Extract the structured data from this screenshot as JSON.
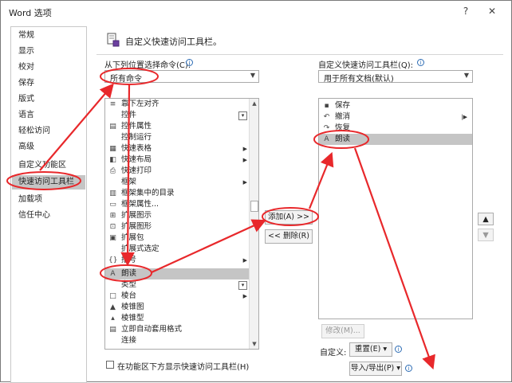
{
  "window": {
    "title": "Word 选项",
    "help_glyph": "?",
    "close_glyph": "✕"
  },
  "sidebar": {
    "items": [
      {
        "label": "常规"
      },
      {
        "label": "显示"
      },
      {
        "label": "校对"
      },
      {
        "label": "保存"
      },
      {
        "label": "版式"
      },
      {
        "label": "语言"
      },
      {
        "label": "轻松访问"
      },
      {
        "label": "高级"
      },
      {
        "label": "自定义功能区"
      },
      {
        "label": "快速访问工具栏",
        "active": true
      },
      {
        "label": "加载项"
      },
      {
        "label": "信任中心"
      }
    ]
  },
  "header": {
    "title": "自定义快速访问工具栏。"
  },
  "left_panel": {
    "choose_label": "从下列位置选择命令(C):",
    "choose_value": "所有命令",
    "commands": [
      {
        "label": "靠下左对齐",
        "icon": "align-icon"
      },
      {
        "label": "控件",
        "icon": "",
        "dropdown": true
      },
      {
        "label": "控件属性",
        "icon": "properties-icon"
      },
      {
        "label": "控制运行",
        "icon": ""
      },
      {
        "label": "快速表格",
        "icon": "table-icon",
        "submenu": true
      },
      {
        "label": "快速布局",
        "icon": "layout-icon",
        "submenu": true
      },
      {
        "label": "快速打印",
        "icon": "print-icon"
      },
      {
        "label": "框架",
        "icon": "",
        "submenu": true
      },
      {
        "label": "框架集中的目录",
        "icon": "frameset-icon"
      },
      {
        "label": "框架属性...",
        "icon": "frame-props-icon"
      },
      {
        "label": "扩展图示",
        "icon": "expand-diagram-icon"
      },
      {
        "label": "扩展图形",
        "icon": "expand-shape-icon"
      },
      {
        "label": "扩展包",
        "icon": "package-icon"
      },
      {
        "label": "扩展式选定",
        "icon": ""
      },
      {
        "label": "括号",
        "icon": "bracket-icon",
        "submenu": true
      },
      {
        "label": "朗读",
        "icon": "read-aloud-icon",
        "selected": true
      },
      {
        "label": "类型",
        "icon": ""
      },
      {
        "label": "棱台",
        "icon": "bevel-icon",
        "submenu": true
      },
      {
        "label": "棱锥图",
        "icon": "pyramid-icon"
      },
      {
        "label": "棱锥型",
        "icon": "pyramid2-icon"
      },
      {
        "label": "立即自动套用格式",
        "icon": "autoformat-icon"
      },
      {
        "label": "连接",
        "icon": ""
      }
    ],
    "bottom_checkbox_label": "在功能区下方显示快速访问工具栏(H)"
  },
  "middle": {
    "add_label": "添加(A) >>",
    "remove_label": "<< 删除(R)"
  },
  "right_panel": {
    "customize_label": "自定义快速访问工具栏(Q):",
    "customize_value": "用于所有文档(默认)",
    "toolbar_items": [
      {
        "label": "保存",
        "icon": "save-icon"
      },
      {
        "label": "撤消",
        "icon": "undo-icon",
        "submenu_bar": true
      },
      {
        "label": "恢复",
        "icon": "redo-icon"
      },
      {
        "label": "朗读",
        "icon": "read-aloud-icon",
        "selected": true
      }
    ],
    "modify_label": "修改(M)...",
    "customize_row_label": "自定义:",
    "reset_label": "重置(E) ▾",
    "import_export_label": "导入/导出(P) ▾",
    "up_glyph": "▲",
    "down_glyph": "▼"
  },
  "colors": {
    "annotation": "#e8282b",
    "selection": "#c5c5c5",
    "info": "#2e6db5"
  }
}
